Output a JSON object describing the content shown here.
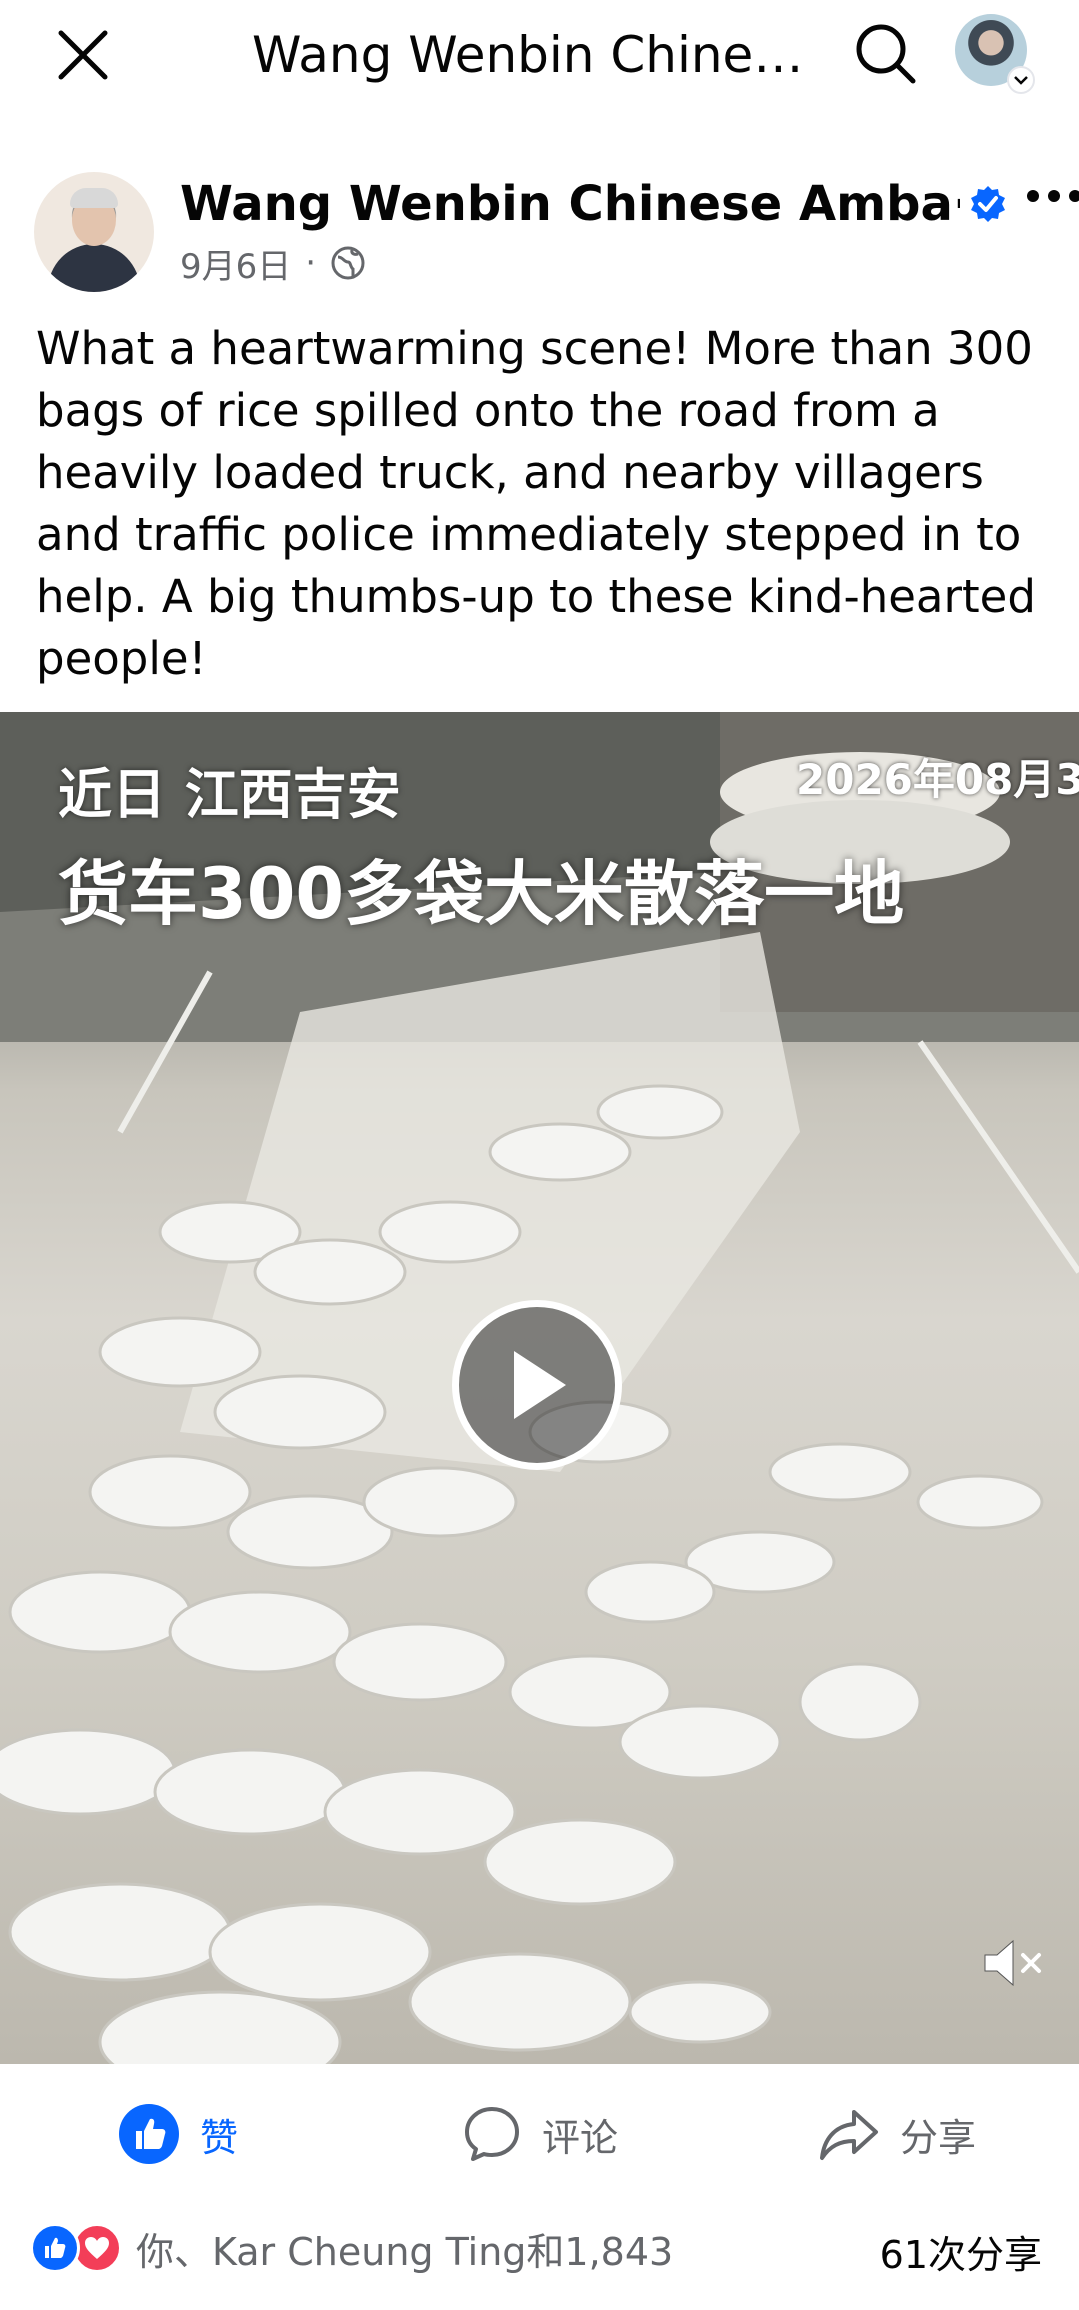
{
  "topbar": {
    "close_icon": "close-icon",
    "title": "Wang Wenbin Chines···",
    "search_icon": "search-icon",
    "profile_icon": "profile-avatar"
  },
  "post": {
    "author": "Wang Wenbin Chinese Amba···",
    "verified_icon": "verified-badge-icon",
    "date": "9月6日",
    "separator": "·",
    "audience_icon": "globe-icon",
    "text": "What a heartwarming scene! More than 300 bags of rice spilled onto the road from a heavily loaded truck, and nearby villagers and traffic police immediately stepped in to help. A big thumbs-up to these kind-hearted people!",
    "more_icon": "more-options-icon"
  },
  "video": {
    "caption_line1": "近日 江西吉安",
    "caption_line2": "货车300多袋大米散落一地",
    "timestamp": "2026年08月3",
    "play_icon": "play-icon",
    "mute_icon": "muted-speaker-icon"
  },
  "actions": {
    "like_label": "赞",
    "comment_label": "评论",
    "share_label": "分享"
  },
  "reactions": {
    "summary": "你、Kar Cheung Ting和1,843",
    "shares": "61次分享"
  },
  "colors": {
    "accent": "#0866ff",
    "secondary_text": "#65676b",
    "love": "#f33e58"
  }
}
